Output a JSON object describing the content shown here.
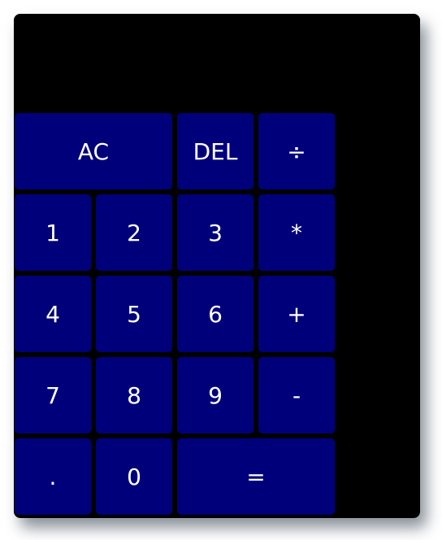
{
  "display": {
    "value": ""
  },
  "keys": {
    "clear": "AC",
    "delete": "DEL",
    "divide": "÷",
    "one": "1",
    "two": "2",
    "three": "3",
    "multiply": "*",
    "four": "4",
    "five": "5",
    "six": "6",
    "add": "+",
    "seven": "7",
    "eight": "8",
    "nine": "9",
    "subtract": "-",
    "decimal": ".",
    "zero": "0",
    "equals": "="
  },
  "colors": {
    "key_background": "#00007a",
    "body_background": "#000000",
    "key_text": "#ffffff"
  }
}
